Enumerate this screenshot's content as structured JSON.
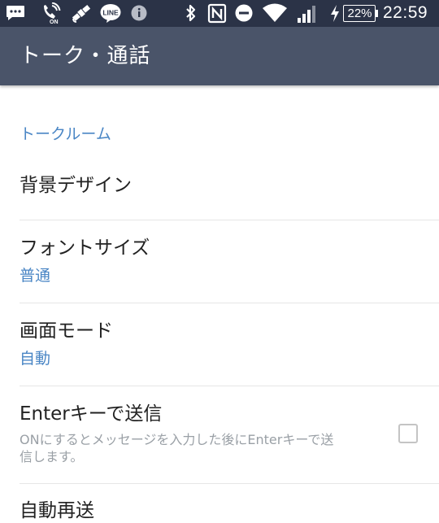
{
  "statusbar": {
    "time": "22:59",
    "battery_percent": "22%",
    "left_icons": [
      "message-icon",
      "silent-on-icon",
      "satellite-icon",
      "line-app-icon",
      "info-icon"
    ],
    "right_icons": [
      "bluetooth-icon",
      "nfc-icon",
      "do-not-disturb-icon",
      "wifi-icon",
      "signal-icon",
      "charging-icon",
      "battery-icon"
    ],
    "line_badge": "LINE",
    "on_badge": "ON"
  },
  "appbar": {
    "title": "トーク・通話"
  },
  "section": {
    "header": "トークルーム"
  },
  "settings": [
    {
      "title": "背景デザイン"
    },
    {
      "title": "フォントサイズ",
      "value": "普通"
    },
    {
      "title": "画面モード",
      "value": "自動"
    },
    {
      "title": "Enterキーで送信",
      "description_line1": "ONにするとメッセージを入力した後にEnterキーで送",
      "description_line2": "信します。",
      "checked": false
    },
    {
      "title": "自動再送"
    }
  ],
  "colors": {
    "statusbar_bg": "#2b3347",
    "appbar_bg": "#4a5469",
    "accent": "#4a86c5",
    "title_text": "#222222",
    "desc_text": "#9aa0a6"
  }
}
